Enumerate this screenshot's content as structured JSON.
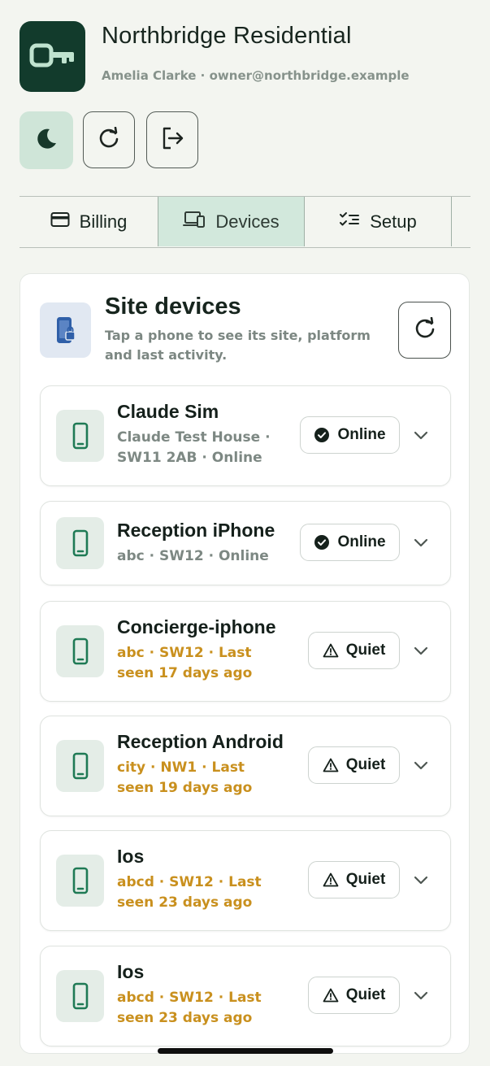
{
  "header": {
    "title": "Northbridge Residential",
    "subtitle": "Amelia Clarke · owner@northbridge.example",
    "logo_icon": "key-icon"
  },
  "actions": {
    "theme_icon": "moon-icon",
    "refresh_icon": "refresh-icon",
    "signout_icon": "sign-out-icon"
  },
  "tabs": [
    {
      "label": "Billing",
      "icon": "credit-card-icon",
      "active": false
    },
    {
      "label": "Devices",
      "icon": "devices-icon",
      "active": true
    },
    {
      "label": "Setup",
      "icon": "checklist-icon",
      "active": false
    }
  ],
  "devices_card": {
    "title": "Site devices",
    "subtitle": "Tap a phone to see its site, platform and last activity.",
    "header_icon": "phone-lock-icon",
    "refresh_icon": "refresh-icon"
  },
  "devices": [
    {
      "name": "Claude Sim",
      "meta": "Claude Test House · SW11 2AB · Online",
      "status": "Online",
      "state": "online"
    },
    {
      "name": "Reception iPhone",
      "meta": "abc · SW12 · Online",
      "status": "Online",
      "state": "online"
    },
    {
      "name": "Concierge-iphone",
      "meta": "abc · SW12 · Last seen 17 days ago",
      "status": "Quiet",
      "state": "quiet"
    },
    {
      "name": "Reception Android",
      "meta": "city · NW1 · Last seen 19 days ago",
      "status": "Quiet",
      "state": "quiet"
    },
    {
      "name": "Ios",
      "meta": "abcd · SW12 · Last seen 23 days ago",
      "status": "Quiet",
      "state": "quiet"
    },
    {
      "name": "Ios",
      "meta": "abcd · SW12 · Last seen 23 days ago",
      "status": "Quiet",
      "state": "quiet"
    }
  ],
  "colors": {
    "brand_dark": "#123b2c",
    "accent_green": "#1f7a55",
    "tab_active_bg": "#d2e8dc",
    "warn_text": "#c9901e",
    "muted_text": "#7d8883"
  }
}
